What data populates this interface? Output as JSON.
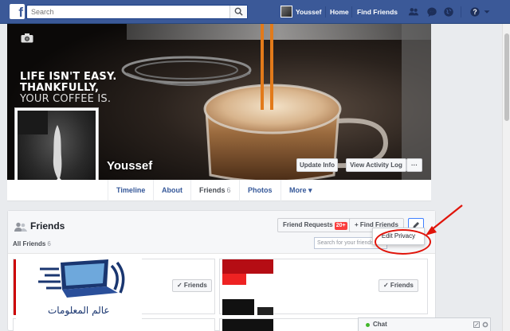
{
  "topbar": {
    "logo": "f",
    "search_placeholder": "Search",
    "user_name": "Youssef",
    "home_label": "Home",
    "find_friends_label": "Find Friends"
  },
  "cover": {
    "slogan_line1": "LIFE ISN'T EASY.",
    "slogan_line2": "THANKFULLY,",
    "slogan_line3": "YOUR COFFEE IS.",
    "name": "Youssef",
    "update_info_label": "Update Info",
    "activity_log_label": "View Activity Log",
    "more_label": "···"
  },
  "tabs": [
    {
      "label": "Timeline"
    },
    {
      "label": "About"
    },
    {
      "label": "Friends",
      "count": "6"
    },
    {
      "label": "Photos"
    },
    {
      "label": "More ▾"
    }
  ],
  "friends": {
    "title": "Friends",
    "requests_label": "Friend Requests",
    "requests_badge": "20+",
    "find_friends_label": "+ Find Friends",
    "all_friends_label": "All Friends",
    "all_friends_count": "6",
    "search_placeholder": "Search for your friends",
    "edit_privacy_label": "Edit Privacy",
    "friends_button_label": "✓ Friends"
  },
  "watermark": {
    "text": "عالم المعلومات"
  },
  "chat": {
    "label": "Chat"
  },
  "colors": {
    "brand": "#3b5998",
    "annotation": "#e0140a"
  }
}
